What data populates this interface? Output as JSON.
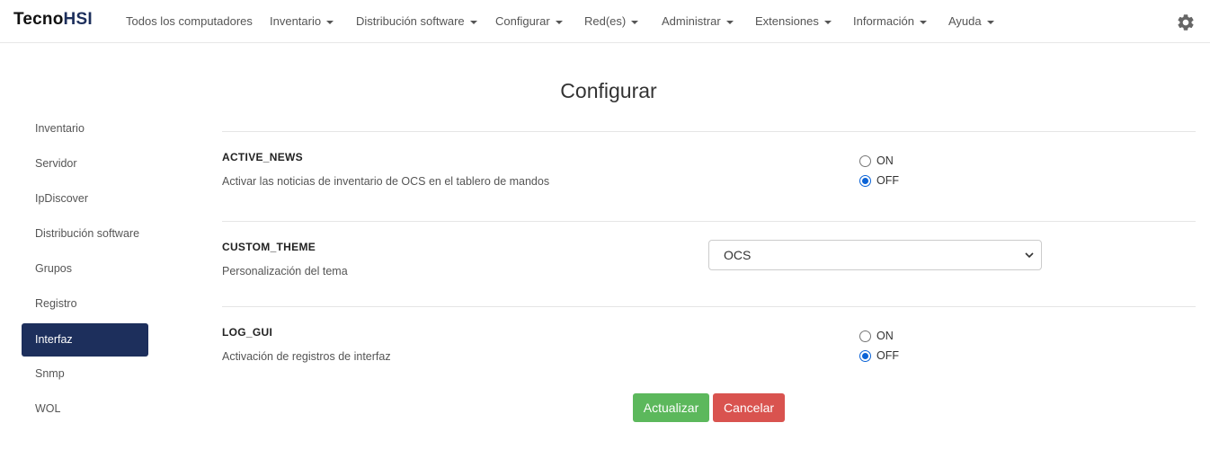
{
  "brand": {
    "prefix": "Tecno",
    "suffix": "HSI"
  },
  "nav": {
    "items": [
      {
        "label": "Todos los computadores",
        "dropdown": false
      },
      {
        "label": "Inventario",
        "dropdown": true
      },
      {
        "label": "Distribución software",
        "dropdown": true
      },
      {
        "label": "Configurar",
        "dropdown": true
      },
      {
        "label": "Red(es)",
        "dropdown": true
      },
      {
        "label": "Administrar",
        "dropdown": true
      },
      {
        "label": "Extensiones",
        "dropdown": true
      },
      {
        "label": "Información",
        "dropdown": true
      },
      {
        "label": "Ayuda",
        "dropdown": true
      }
    ],
    "settings_icon": "gear-icon"
  },
  "sidebar": {
    "items": [
      {
        "label": "Inventario"
      },
      {
        "label": "Servidor"
      },
      {
        "label": "IpDiscover"
      },
      {
        "label": "Distribución software"
      },
      {
        "label": "Grupos"
      },
      {
        "label": "Registro"
      },
      {
        "label": "Interfaz",
        "active": true
      },
      {
        "label": "Snmp"
      },
      {
        "label": "WOL"
      }
    ]
  },
  "main": {
    "title": "Configurar",
    "options": [
      {
        "name": "ACTIVE_NEWS",
        "description": "Activar las noticias de inventario de OCS en el tablero de mandos",
        "type": "radio",
        "choices": [
          "ON",
          "OFF"
        ],
        "selected": "OFF"
      },
      {
        "name": "CUSTOM_THEME",
        "description": "Personalización del tema",
        "type": "select",
        "value": "OCS"
      },
      {
        "name": "LOG_GUI",
        "description": "Activación de registros de interfaz",
        "type": "radio",
        "choices": [
          "ON",
          "OFF"
        ],
        "selected": "OFF"
      }
    ],
    "buttons": {
      "update_label": "Actualizar",
      "cancel_label": "Cancelar"
    }
  },
  "colors": {
    "brand_accent": "#1d2f5c",
    "update_button": "#5cb85c",
    "cancel_button": "#d9534f",
    "radio_checked": "#0b63d6"
  }
}
